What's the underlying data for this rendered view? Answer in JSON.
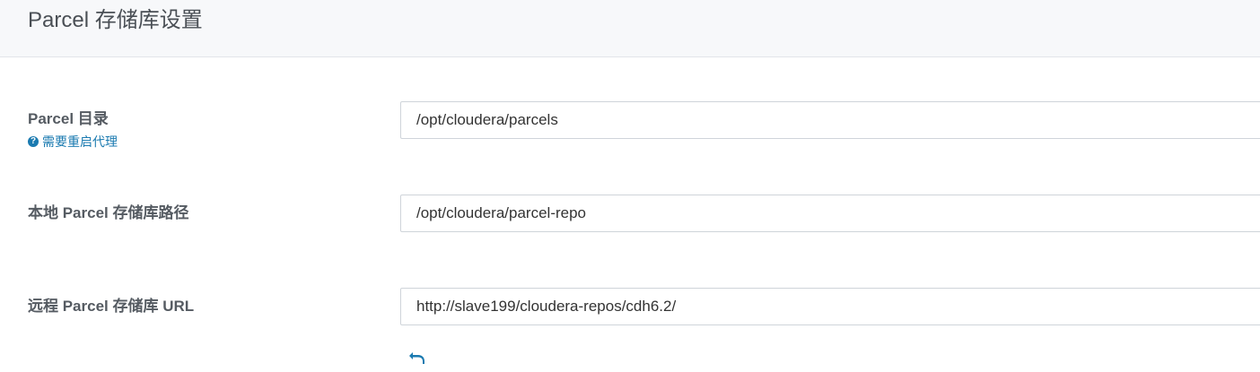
{
  "header": {
    "title": "Parcel 存储库设置"
  },
  "fields": [
    {
      "label": "Parcel 目录",
      "hint": "需要重启代理",
      "value": "/opt/cloudera/parcels"
    },
    {
      "label": "本地 Parcel 存储库路径",
      "value": "/opt/cloudera/parcel-repo"
    },
    {
      "label": "远程 Parcel 存储库 URL",
      "value": "http://slave199/cloudera-repos/cdh6.2/"
    }
  ],
  "icons": {
    "hint_icon": "question-circle-icon",
    "undo_icon": "undo-arrow-icon"
  },
  "colors": {
    "link": "#1a7ab0",
    "header_bg": "#f7f8fa"
  }
}
